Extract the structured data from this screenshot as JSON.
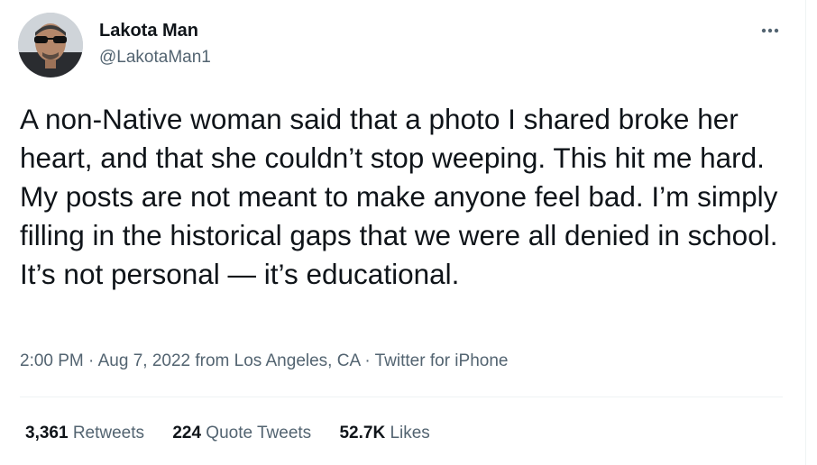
{
  "author": {
    "display_name": "Lakota Man",
    "handle": "@LakotaMan1"
  },
  "tweet": {
    "text": "A non-Native woman said that a photo I shared broke her heart, and that she couldn’t stop weeping. This hit me hard. My posts are not meant to make anyone feel bad. I’m simply filling in the historical gaps that we were all denied in school. It’s not personal — it’s educational.",
    "time": "2:00 PM",
    "separator": "·",
    "date_location": "Aug 7, 2022 from Los Angeles, CA",
    "client": "Twitter for iPhone"
  },
  "stats": {
    "retweets_count": "3,361",
    "retweets_label": "Retweets",
    "quotes_count": "224",
    "quotes_label": "Quote Tweets",
    "likes_count": "52.7K",
    "likes_label": "Likes"
  },
  "icons": {
    "more": "more-horizontal-icon"
  },
  "colors": {
    "text_primary": "#0f1419",
    "text_secondary": "#536471",
    "divider": "#eff3f4"
  }
}
